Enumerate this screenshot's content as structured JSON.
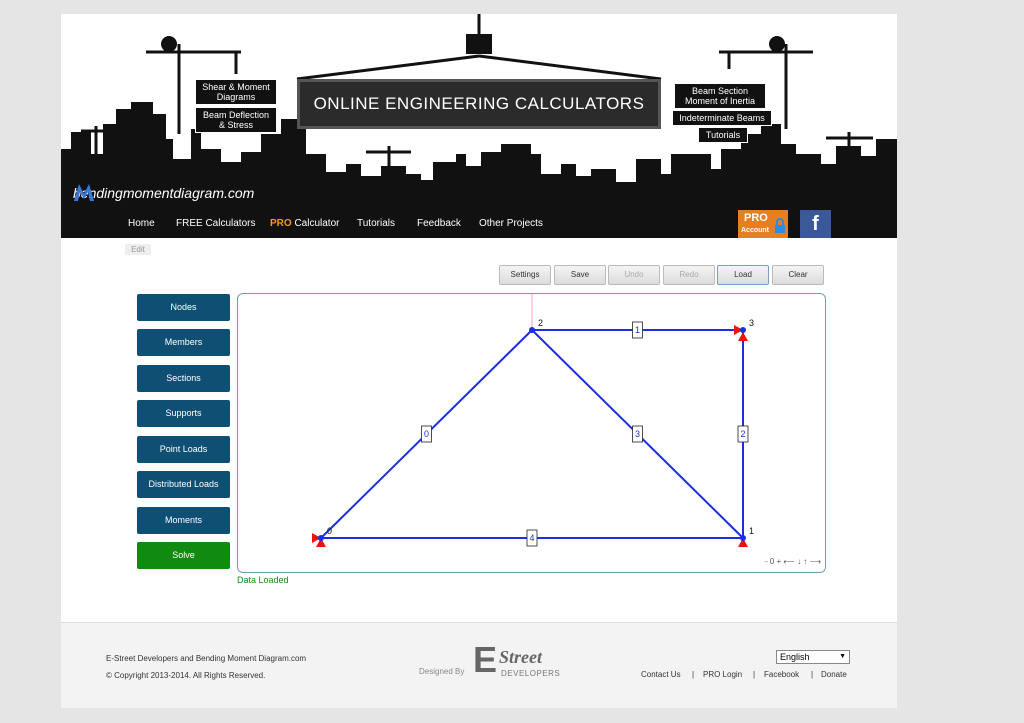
{
  "banner": {
    "main_title": "ONLINE ENGINEERING CALCULATORS",
    "signs": {
      "shear": "Shear & Moment Diagrams",
      "deflection": "Beam Deflection & Stress",
      "section": "Beam Section Moment of Inertia",
      "indeterminate": "Indeterminate Beams",
      "tutorials": "Tutorials"
    },
    "logo_text": "bendingmomentdiagram.com"
  },
  "nav": {
    "items": [
      "Home",
      "FREE Calculators",
      "PRO",
      "Calculator",
      "Tutorials",
      "Feedback",
      "Other Projects"
    ],
    "pro_account_top": "PRO",
    "pro_account_bottom": "Account",
    "facebook": "f"
  },
  "edit_label": "Edit",
  "toolbar": {
    "settings": "Settings",
    "save": "Save",
    "undo": "Undo",
    "redo": "Redo",
    "load": "Load",
    "clear": "Clear"
  },
  "sidebar": {
    "items": [
      "Nodes",
      "Members",
      "Sections",
      "Supports",
      "Point Loads",
      "Distributed Loads",
      "Moments"
    ],
    "solve": "Solve"
  },
  "model": {
    "nodes": [
      {
        "id": "0",
        "x": 0,
        "y": 0
      },
      {
        "id": "1",
        "x": 4,
        "y": 0
      },
      {
        "id": "2",
        "x": 2,
        "y": 2
      },
      {
        "id": "3",
        "x": 4,
        "y": 2
      }
    ],
    "members": [
      {
        "id": "0",
        "from": 0,
        "to": 2
      },
      {
        "id": "1",
        "from": 2,
        "to": 3
      },
      {
        "id": "2",
        "from": 1,
        "to": 3
      },
      {
        "id": "3",
        "from": 2,
        "to": 1
      },
      {
        "id": "4",
        "from": 0,
        "to": 1
      }
    ],
    "member_color": "#1a2fe0",
    "support_color": "#ee1111",
    "zoom_controls": "- 0 + ⟵ ↓ ↑ ⟶"
  },
  "status": "Data Loaded",
  "footer": {
    "line1": "E-Street Developers and Bending Moment Diagram.com",
    "line2": "© Copyright 2013-2014. All Rights Reserved.",
    "designed_by": "Designed By",
    "brand_big": "E",
    "brand_script": "Street",
    "brand_sub": "DEVELOPERS",
    "language": "English",
    "links": [
      "Contact Us",
      "PRO Login",
      "Facebook",
      "Donate"
    ]
  }
}
